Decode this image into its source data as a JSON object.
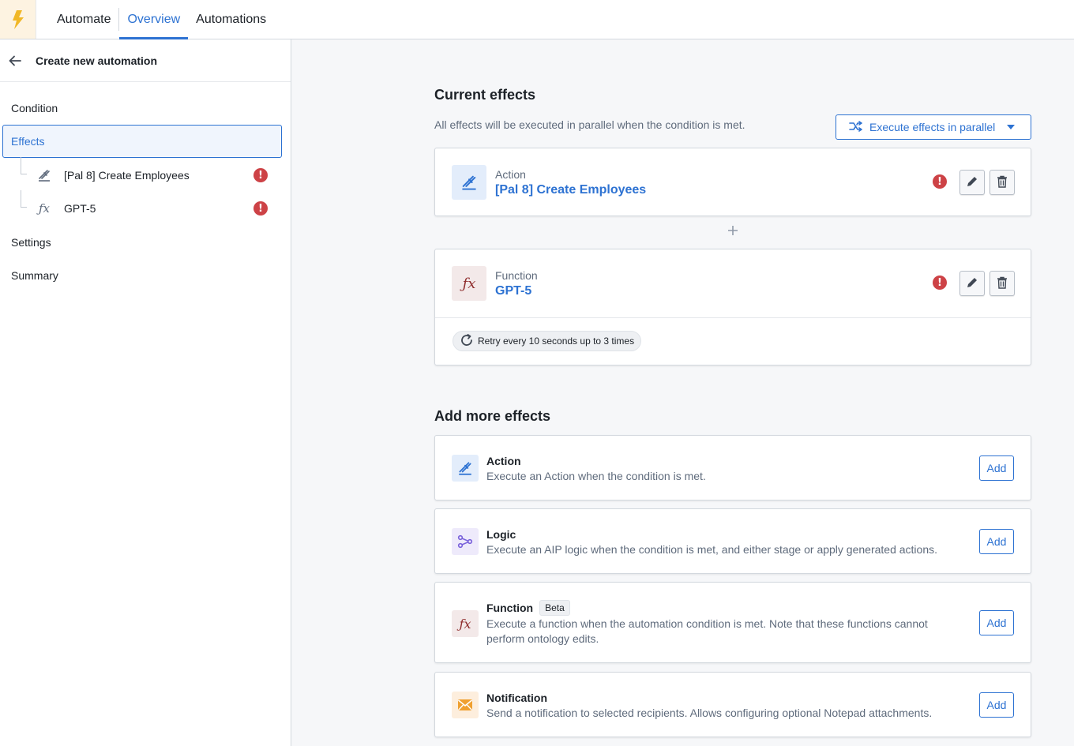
{
  "colors": {
    "accent": "#2d72d2",
    "error": "#cd4246",
    "logo": "#f0b726",
    "logic": "#7961db",
    "function": "#8f2d2d",
    "notification": "#f0a030"
  },
  "topbar": {
    "logo_icon": "lightning-bolt-icon",
    "tabs": [
      {
        "label": "Automate"
      },
      {
        "label": "Overview"
      },
      {
        "label": "Automations"
      }
    ]
  },
  "sidebar": {
    "title": "Create new automation",
    "items": {
      "condition": "Condition",
      "effects": "Effects",
      "settings": "Settings",
      "summary": "Summary"
    },
    "effects": [
      {
        "label": "[Pal 8] Create Employees",
        "icon": "action-icon",
        "error": "!"
      },
      {
        "label": "GPT-5",
        "icon": "function-icon",
        "error": "!"
      }
    ]
  },
  "main": {
    "current_effects": {
      "heading": "Current effects",
      "subtext": "All effects will be executed in parallel when the condition is met.",
      "parallel_button": "Execute effects in parallel",
      "effects": [
        {
          "type": "Action",
          "name": "[Pal 8] Create Employees",
          "error": "!"
        },
        {
          "type": "Function",
          "name": "GPT-5",
          "error": "!",
          "retry": "Retry every 10 seconds up to 3 times"
        }
      ]
    },
    "add_more": {
      "heading": "Add more effects",
      "items": [
        {
          "title": "Action",
          "desc": "Execute an Action when the condition is met.",
          "button": "Add"
        },
        {
          "title": "Logic",
          "desc": "Execute an AIP logic when the condition is met, and either stage or apply generated actions.",
          "button": "Add"
        },
        {
          "title": "Function",
          "tag": "Beta",
          "desc": "Execute a function when the automation condition is met. Note that these functions cannot perform ontology edits.",
          "button": "Add"
        },
        {
          "title": "Notification",
          "desc": "Send a notification to selected recipients. Allows configuring optional Notepad attachments.",
          "button": "Add"
        }
      ]
    }
  }
}
